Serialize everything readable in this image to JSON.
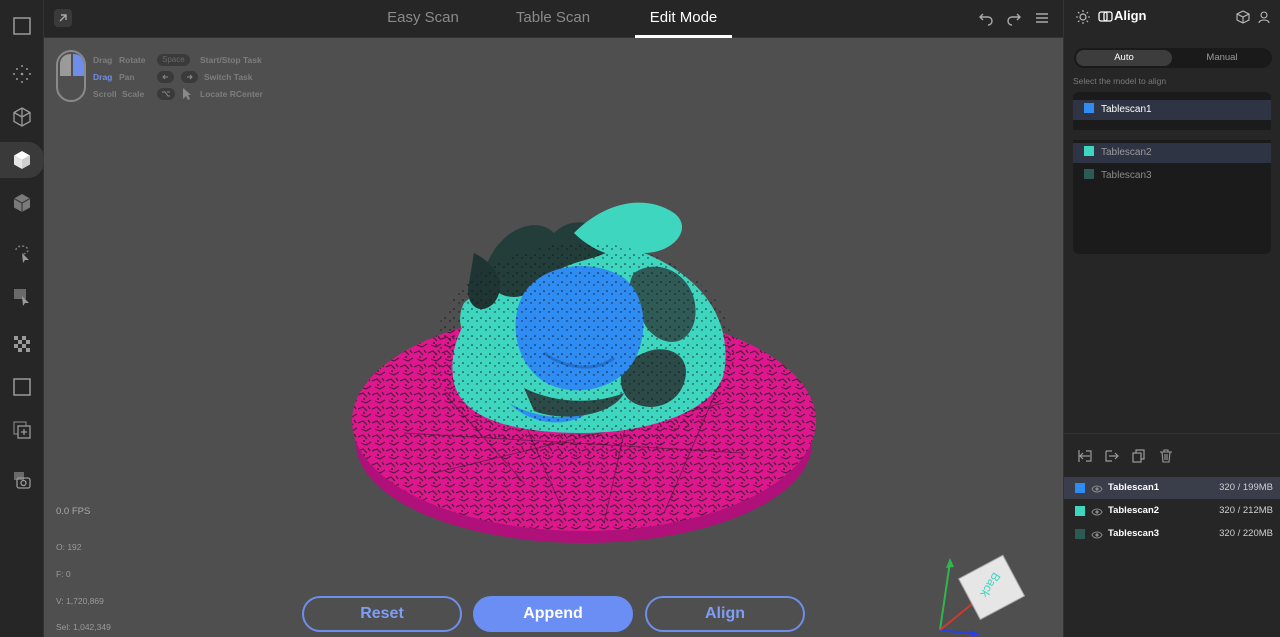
{
  "top_bar": {
    "tabs": [
      "Easy Scan",
      "Table Scan",
      "Edit Mode"
    ],
    "active_tab": "Edit Mode"
  },
  "hints": {
    "drag1": "Drag",
    "rotate": "Rotate",
    "drag2": "Drag",
    "pan": "Pan",
    "scroll": "Scroll",
    "scale": "Scale",
    "space_key": "Space",
    "start_stop": "Start/Stop Task",
    "switch_task": "Switch Task",
    "locate": "Locate RCenter"
  },
  "stats": {
    "fps": "0.0 FPS",
    "o": "O: 192",
    "f": "F: 0",
    "v": "V: 1,720,869",
    "sel": "Sel: 1,042,349"
  },
  "buttons": {
    "reset": "Reset",
    "append": "Append",
    "align": "Align"
  },
  "gizmo": {
    "face_label": "Back"
  },
  "right_panel": {
    "title": "Align",
    "seg_auto": "Auto",
    "seg_manual": "Manual",
    "subtitle": "Select the model to align",
    "fixed_models": [
      {
        "name": "Tablescan1",
        "color": "#2f8cf2"
      }
    ],
    "moving_models": [
      {
        "name": "Tablescan2",
        "color": "#3fd6c0"
      },
      {
        "name": "Tablescan3",
        "color": "#2c5a55"
      }
    ],
    "scan_list": [
      {
        "name": "Tablescan1",
        "size": "320 / 199MB",
        "color": "#2f8cf2"
      },
      {
        "name": "Tablescan2",
        "size": "320 / 212MB",
        "color": "#3fd6c0"
      },
      {
        "name": "Tablescan3",
        "size": "320 / 220MB",
        "color": "#2c5a55"
      }
    ]
  },
  "colors": {
    "accent": "#6a8ef4",
    "base_magenta": "#e0168f",
    "viewport_bg": "#4f4f4f"
  }
}
